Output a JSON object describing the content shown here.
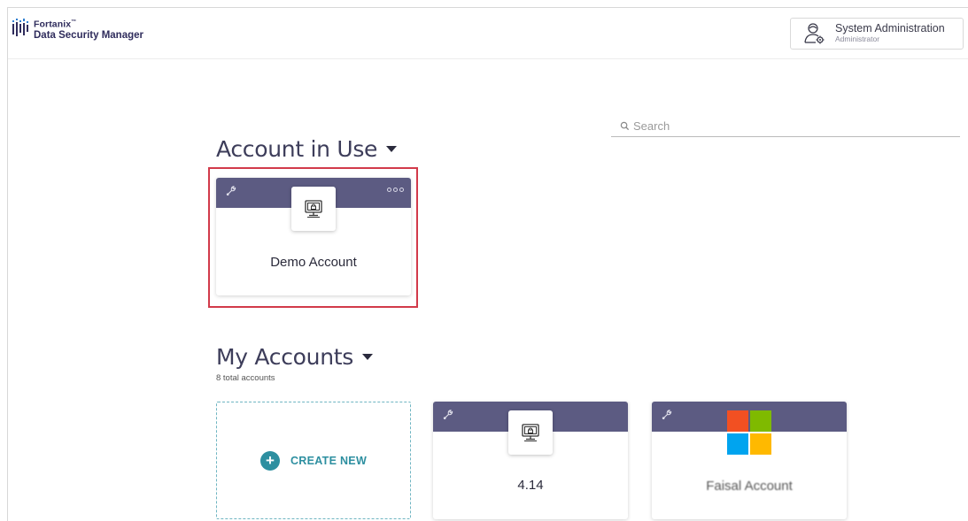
{
  "header": {
    "brand": "Fortanix",
    "brand_mark": "™",
    "product": "Data Security Manager",
    "user": {
      "name": "System Administration",
      "role": "Administrator"
    }
  },
  "search": {
    "placeholder": "Search",
    "icon": "search-icon"
  },
  "account_in_use": {
    "title": "Account in Use",
    "card": {
      "name": "Demo Account",
      "icon": "computer-lock-icon",
      "selected": true
    }
  },
  "my_accounts": {
    "title": "My Accounts",
    "count_text": "8 total accounts",
    "create_label": "CREATE NEW",
    "cards": [
      {
        "name": "4.14",
        "icon": "computer-lock-icon"
      },
      {
        "name": "Faisal Account",
        "icon": "microsoft-logo-icon"
      }
    ]
  },
  "colors": {
    "card_band": "#5c5b82",
    "accent_teal": "#2d8fa0",
    "highlight_red": "#d23a4a",
    "brand_navy": "#2f2c5c"
  }
}
